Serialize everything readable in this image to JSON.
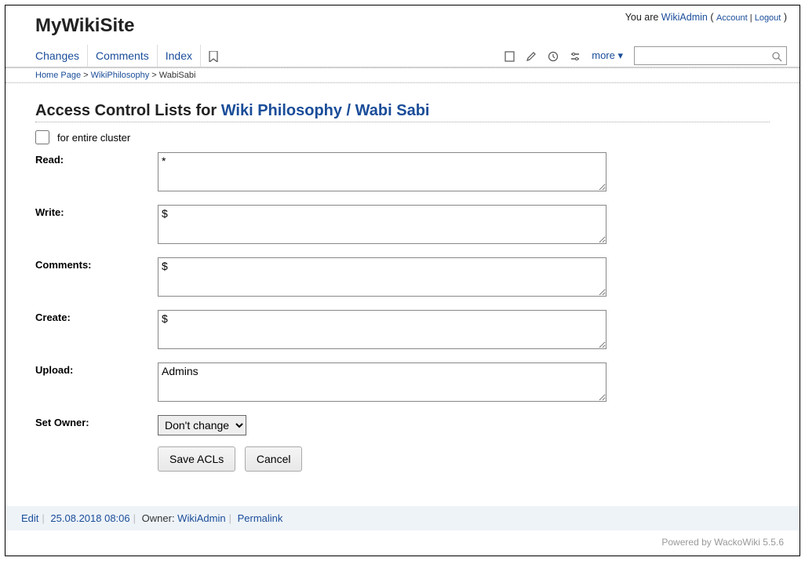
{
  "site_title": "MyWikiSite",
  "user_bar": {
    "prefix": "You are ",
    "username": "WikiAdmin",
    "account": "Account",
    "logout": "Logout"
  },
  "nav": {
    "changes": "Changes",
    "comments": "Comments",
    "index": "Index",
    "more": "more ▾"
  },
  "search": {
    "placeholder": ""
  },
  "breadcrumb": {
    "home": "Home Page",
    "parent": "WikiPhilosophy",
    "current": "WabiSabi"
  },
  "heading": {
    "prefix": "Access Control Lists for ",
    "link": "Wiki Philosophy / Wabi Sabi"
  },
  "cluster_label": "for entire cluster",
  "labels": {
    "read": "Read:",
    "write": "Write:",
    "comments": "Comments:",
    "create": "Create:",
    "upload": "Upload:",
    "set_owner": "Set Owner:"
  },
  "values": {
    "read": "*",
    "write": "$",
    "comments": "$",
    "create": "$",
    "upload": "Admins",
    "set_owner": "Don't change"
  },
  "buttons": {
    "save": "Save ACLs",
    "cancel": "Cancel"
  },
  "footer": {
    "edit": "Edit",
    "date": "25.08.2018 08:06",
    "owner_label": "Owner: ",
    "owner": "WikiAdmin",
    "permalink": "Permalink"
  },
  "powered": "Powered by WackoWiki 5.5.6"
}
